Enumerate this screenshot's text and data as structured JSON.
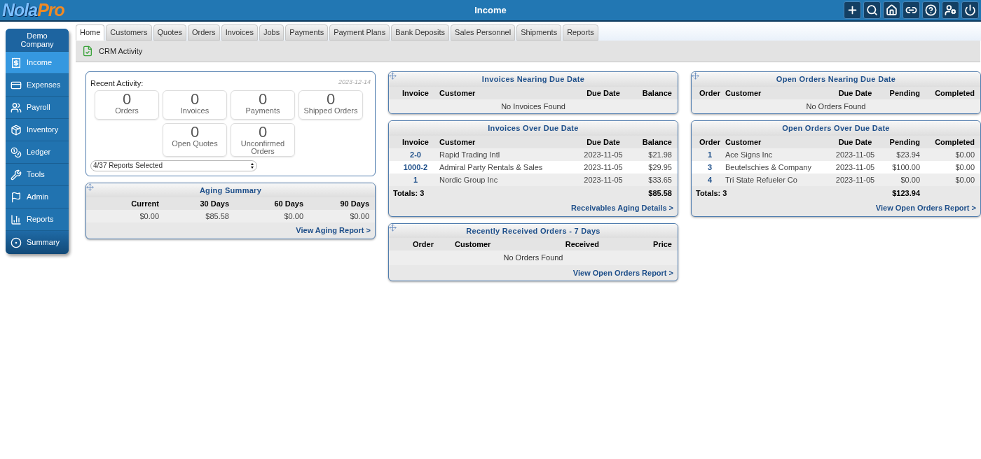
{
  "header": {
    "logo": [
      "Nola",
      "Pro"
    ],
    "title": "Income"
  },
  "sidebar": {
    "company": "Demo Company",
    "items": [
      {
        "label": "Income",
        "kind": "nav",
        "selected": true
      },
      {
        "label": "Expenses",
        "kind": "nav",
        "selected": false
      },
      {
        "label": "Payroll",
        "kind": "nav",
        "selected": false
      },
      {
        "label": "Inventory",
        "kind": "nav",
        "selected": false
      },
      {
        "label": "Ledger",
        "kind": "nav",
        "selected": false
      },
      {
        "label": "Tools",
        "kind": "nav",
        "selected": false
      },
      {
        "label": "Admin",
        "kind": "nav",
        "selected": false
      },
      {
        "label": "Reports",
        "kind": "nav",
        "selected": false
      },
      {
        "label": "Summary",
        "kind": "footer",
        "selected": false
      }
    ]
  },
  "tabs": [
    {
      "label": "Home",
      "selected": true
    },
    {
      "label": "Customers",
      "selected": false
    },
    {
      "label": "Quotes",
      "selected": false
    },
    {
      "label": "Orders",
      "selected": false
    },
    {
      "label": "Invoices",
      "selected": false
    },
    {
      "label": "Jobs",
      "selected": false
    },
    {
      "label": "Payments",
      "selected": false
    },
    {
      "label": "Payment Plans",
      "selected": false
    },
    {
      "label": "Bank Deposits",
      "selected": false
    },
    {
      "label": "Sales Personnel",
      "selected": false
    },
    {
      "label": "Shipments",
      "selected": false
    },
    {
      "label": "Reports",
      "selected": false
    }
  ],
  "subbar": {
    "link": "CRM Activity"
  },
  "recent_activity": {
    "title": "Recent Activity:",
    "date": "2023-12-14",
    "tiles": [
      {
        "count": "0",
        "label": "Orders"
      },
      {
        "count": "0",
        "label": "Invoices"
      },
      {
        "count": "0",
        "label": "Payments"
      },
      {
        "count": "0",
        "label": "Shipped Orders"
      },
      {
        "count": "0",
        "label": "Open Quotes"
      },
      {
        "count": "0",
        "label": "Unconfirmed Orders"
      }
    ],
    "select": {
      "value": "4/37 Reports Selected"
    }
  },
  "columns": [
    [
      {
        "title": "Aging Summary",
        "kind": "aging",
        "draggable": true,
        "columns": [
          "Current",
          "30 Days",
          "60 Days",
          "90 Days"
        ],
        "rows": [
          [
            "$0.00",
            "$85.58",
            "$0.00",
            "$0.00"
          ]
        ],
        "link": "View Aging Report >"
      }
    ],
    [
      {
        "title": "Invoices Nearing Due Date",
        "kind": "invoices",
        "draggable": true,
        "columns": [
          "Invoice",
          "Customer",
          "Due Date",
          "Balance"
        ],
        "empty": "No Invoices Found"
      },
      {
        "title": "Invoices Over Due Date",
        "kind": "invoices",
        "draggable": false,
        "columns": [
          "Invoice",
          "Customer",
          "Due Date",
          "Balance"
        ],
        "rows": [
          [
            "2-0",
            "Rapid Trading Intl",
            "2023-11-05",
            "$21.98"
          ],
          [
            "1000-2",
            "Admiral Party Rentals & Sales",
            "2023-11-05",
            "$29.95"
          ],
          [
            "1",
            "Nordic Group Inc",
            "2023-11-05",
            "$33.65"
          ]
        ],
        "totals": {
          "label": "Totals: 3",
          "balance": "$85.58"
        },
        "link": "Receivables Aging Details >"
      },
      {
        "title": "Recently Received Orders - 7 Days",
        "kind": "received",
        "draggable": true,
        "columns": [
          "Order",
          "Customer",
          "Received",
          "Price"
        ],
        "empty": "No Orders Found",
        "link": "View Open Orders Report >"
      }
    ],
    [
      {
        "title": "Open Orders Nearing Due Date",
        "kind": "orders",
        "draggable": true,
        "columns": [
          "Order",
          "Customer",
          "Due Date",
          "Pending",
          "Completed"
        ],
        "empty": "No Orders Found"
      },
      {
        "title": "Open Orders Over Due Date",
        "kind": "orders",
        "draggable": false,
        "columns": [
          "Order",
          "Customer",
          "Due Date",
          "Pending",
          "Completed"
        ],
        "rows": [
          [
            "1",
            "Ace Signs Inc",
            "2023-11-05",
            "$23.94",
            "$0.00"
          ],
          [
            "3",
            "Beutelschies & Company",
            "2023-11-05",
            "$100.00",
            "$0.00"
          ],
          [
            "4",
            "Tri State Refueler Co",
            "2023-11-05",
            "$0.00",
            "$0.00"
          ]
        ],
        "totals": {
          "label": "Totals: 3",
          "pending": "$123.94"
        },
        "link": "View Open Orders Report >"
      }
    ]
  ]
}
